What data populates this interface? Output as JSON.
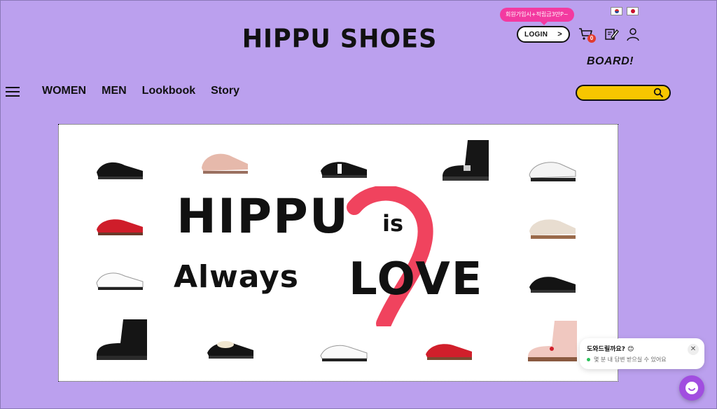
{
  "header": {
    "logo": "HIPPU SHOES",
    "promo_tooltip": "회원가입시+적립금3만P~",
    "login_label": "LOGIN",
    "login_chevron": ">",
    "cart_count": "0",
    "board_label": "BOARD!",
    "flags": [
      "south-korea-flag",
      "japan-flag"
    ]
  },
  "nav": {
    "items": [
      "WOMEN",
      "MEN",
      "Lookbook",
      "Story"
    ]
  },
  "search": {
    "placeholder": ""
  },
  "banner": {
    "line1": "HIPPU",
    "line1_suffix": "is",
    "line2": "Always",
    "line2_suffix": "LOVE",
    "accent_color": "#f0435e"
  },
  "chat": {
    "title": "도와드릴까요? 😊",
    "subtitle": "몇 분 내 답변 받으실 수 있어요",
    "close_icon": "close-icon"
  },
  "colors": {
    "background": "#bba0ee",
    "search_bg": "#f7c600",
    "promo_bg": "#f33aa0",
    "chat_fab": "#a14de0"
  }
}
